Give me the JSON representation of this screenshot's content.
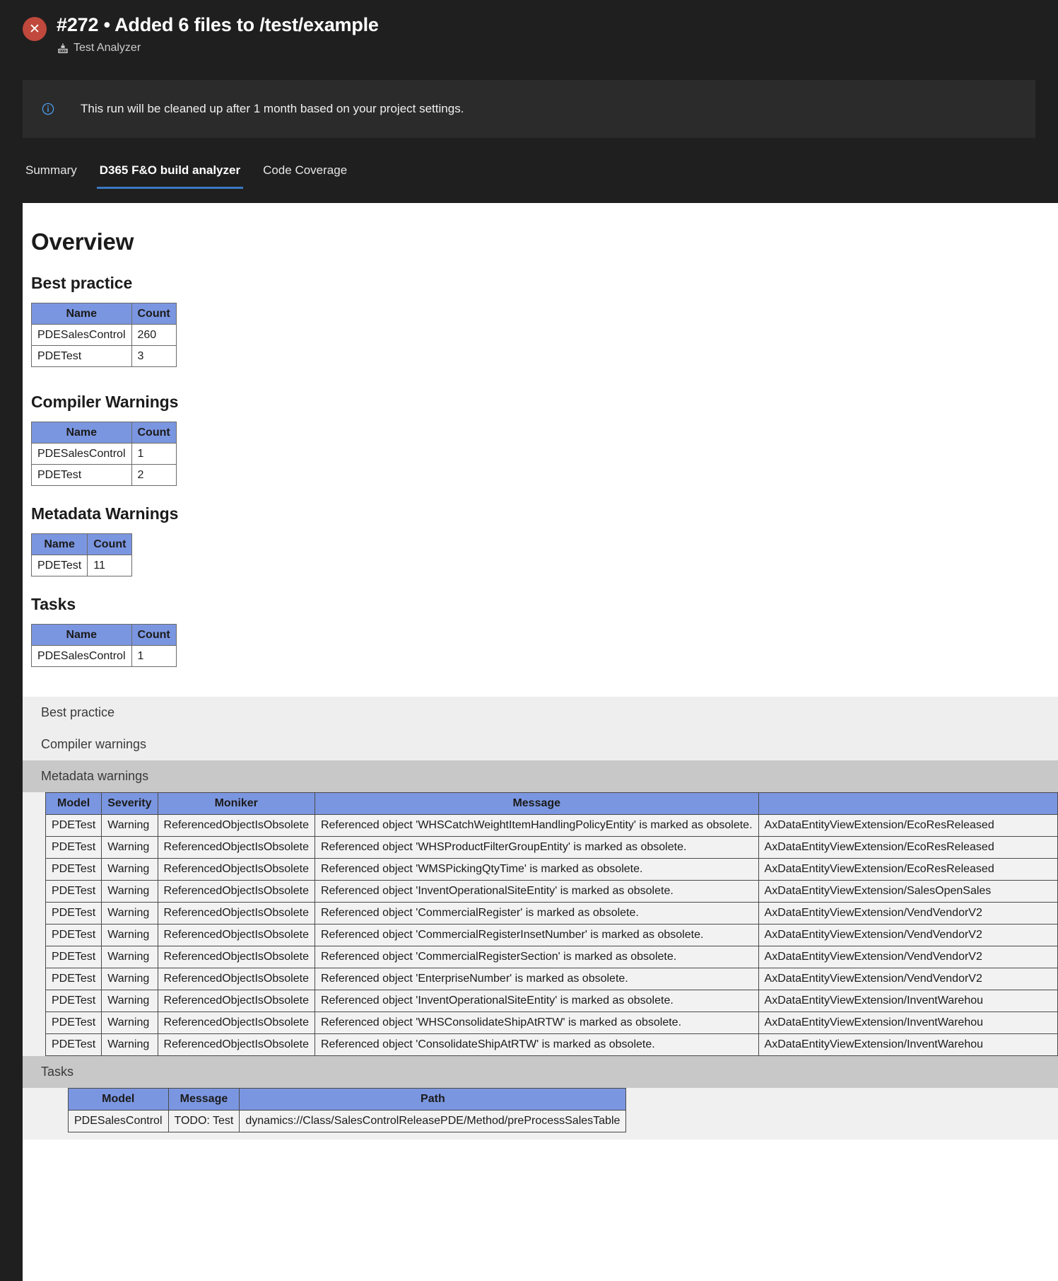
{
  "header": {
    "status_icon": "error-circle-icon",
    "status_glyph": "✕",
    "status_color": "#c0483c",
    "title": "#272 • Added 6 files to /test/example",
    "pipeline_icon": "pipeline-icon",
    "pipeline_name": "Test Analyzer"
  },
  "info_banner": {
    "icon": "info-icon",
    "icon_color": "#4c9ae8",
    "message": "This run will be cleaned up after 1 month based on your project settings."
  },
  "tabs": [
    {
      "label": "Summary",
      "active": false
    },
    {
      "label": "D365 F&O build analyzer",
      "active": true
    },
    {
      "label": "Code Coverage",
      "active": false
    }
  ],
  "accent_color": "#3b78c4",
  "table_header_color": "#7b96e0",
  "overview": {
    "title": "Overview",
    "sections": [
      {
        "title": "Best practice",
        "columns": [
          "Name",
          "Count"
        ],
        "rows": [
          [
            "PDESalesControl",
            "260"
          ],
          [
            "PDETest",
            "3"
          ]
        ]
      },
      {
        "title": "Compiler Warnings",
        "columns": [
          "Name",
          "Count"
        ],
        "rows": [
          [
            "PDESalesControl",
            "1"
          ],
          [
            "PDETest",
            "2"
          ]
        ]
      },
      {
        "title": "Metadata Warnings",
        "columns": [
          "Name",
          "Count"
        ],
        "rows": [
          [
            "PDETest",
            "11"
          ]
        ]
      },
      {
        "title": "Tasks",
        "columns": [
          "Name",
          "Count"
        ],
        "rows": [
          [
            "PDESalesControl",
            "1"
          ]
        ]
      }
    ]
  },
  "accordion": {
    "items": [
      {
        "label": "Best practice",
        "expanded": false,
        "style": "light"
      },
      {
        "label": "Compiler warnings",
        "expanded": false,
        "style": "light"
      },
      {
        "label": "Metadata warnings",
        "expanded": true,
        "style": "dark"
      },
      {
        "label": "Tasks",
        "expanded": true,
        "style": "dark"
      }
    ]
  },
  "metadata_warnings_table": {
    "columns": [
      "Model",
      "Severity",
      "Moniker",
      "Message",
      ""
    ],
    "rows": [
      [
        "PDETest",
        "Warning",
        "ReferencedObjectIsObsolete",
        "Referenced object 'WHSCatchWeightItemHandlingPolicyEntity' is marked as obsolete.",
        "AxDataEntityViewExtension/EcoResReleased"
      ],
      [
        "PDETest",
        "Warning",
        "ReferencedObjectIsObsolete",
        "Referenced object 'WHSProductFilterGroupEntity' is marked as obsolete.",
        "AxDataEntityViewExtension/EcoResReleased"
      ],
      [
        "PDETest",
        "Warning",
        "ReferencedObjectIsObsolete",
        "Referenced object 'WMSPickingQtyTime' is marked as obsolete.",
        "AxDataEntityViewExtension/EcoResReleased"
      ],
      [
        "PDETest",
        "Warning",
        "ReferencedObjectIsObsolete",
        "Referenced object 'InventOperationalSiteEntity' is marked as obsolete.",
        "AxDataEntityViewExtension/SalesOpenSales"
      ],
      [
        "PDETest",
        "Warning",
        "ReferencedObjectIsObsolete",
        "Referenced object 'CommercialRegister' is marked as obsolete.",
        "AxDataEntityViewExtension/VendVendorV2"
      ],
      [
        "PDETest",
        "Warning",
        "ReferencedObjectIsObsolete",
        "Referenced object 'CommercialRegisterInsetNumber' is marked as obsolete.",
        "AxDataEntityViewExtension/VendVendorV2"
      ],
      [
        "PDETest",
        "Warning",
        "ReferencedObjectIsObsolete",
        "Referenced object 'CommercialRegisterSection' is marked as obsolete.",
        "AxDataEntityViewExtension/VendVendorV2"
      ],
      [
        "PDETest",
        "Warning",
        "ReferencedObjectIsObsolete",
        "Referenced object 'EnterpriseNumber' is marked as obsolete.",
        "AxDataEntityViewExtension/VendVendorV2"
      ],
      [
        "PDETest",
        "Warning",
        "ReferencedObjectIsObsolete",
        "Referenced object 'InventOperationalSiteEntity' is marked as obsolete.",
        "AxDataEntityViewExtension/InventWarehou"
      ],
      [
        "PDETest",
        "Warning",
        "ReferencedObjectIsObsolete",
        "Referenced object 'WHSConsolidateShipAtRTW' is marked as obsolete.",
        "AxDataEntityViewExtension/InventWarehou"
      ],
      [
        "PDETest",
        "Warning",
        "ReferencedObjectIsObsolete",
        "Referenced object 'ConsolidateShipAtRTW' is marked as obsolete.",
        "AxDataEntityViewExtension/InventWarehou"
      ]
    ]
  },
  "tasks_table": {
    "columns": [
      "Model",
      "Message",
      "Path"
    ],
    "rows": [
      [
        "PDESalesControl",
        "TODO: Test",
        "dynamics://Class/SalesControlReleasePDE/Method/preProcessSalesTable"
      ]
    ]
  }
}
